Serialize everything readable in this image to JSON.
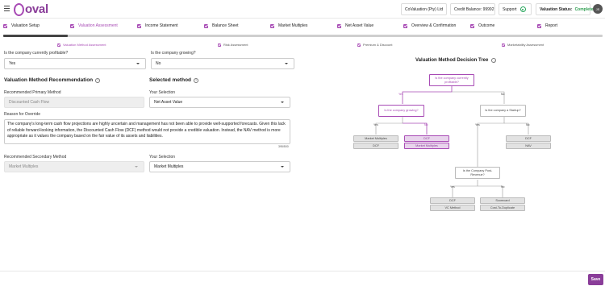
{
  "header": {
    "logo_text": "oval",
    "company": "CoValuation (Pty) Ltd",
    "credit_balance": "Credit Balance: 99992",
    "support": "Support",
    "status_label": "Valuation Status:",
    "status_value": "Complete",
    "avatar_initials": "JS"
  },
  "steps": [
    {
      "label": "Valuation Setup"
    },
    {
      "label": "Valuation Assessment"
    },
    {
      "label": "Income Statement"
    },
    {
      "label": "Balance Sheet"
    },
    {
      "label": "Market Multiples"
    },
    {
      "label": "Net Asset Value"
    },
    {
      "label": "Overview & Confirmation"
    },
    {
      "label": "Outcome"
    },
    {
      "label": "Report"
    }
  ],
  "substeps": [
    {
      "label": "Valuation Method Assessment"
    },
    {
      "label": "Risk Assessment"
    },
    {
      "label": "Premium & Discount"
    },
    {
      "label": "Marketability Assessment"
    }
  ],
  "form": {
    "profitable_label": "Is the company currently profitable?",
    "profitable_value": "Yes",
    "growing_label": "Is the company growing?",
    "growing_value": "No",
    "recommendation_heading": "Valuation Method Recommendation",
    "selected_heading": "Selected method",
    "rec_primary_label": "Recommended Primary Method",
    "rec_primary_value": "Discounted Cash Flow",
    "your_selection_label": "Your Selection",
    "primary_selection": "Net Asset Value",
    "override_label": "Reason for Override",
    "override_text": "The company's long-term cash flow projections are highly uncertain and management has not been able to provide well-supported forecasts. Given this lack of reliable forward-looking information, the Discounted Cash Flow (DCF) method would not provide a credible valuation. Instead, the NAV method is more appropriate as it values the company based on the fair value of its assets and liabilities.",
    "char_count": "395/500",
    "rec_secondary_label": "Recommended Secondary Method",
    "rec_secondary_value": "Market Multiples",
    "secondary_selection_label": "Your Selection",
    "secondary_selection": "Market Multiples"
  },
  "tree": {
    "title": "Valuation Method Decision Tree",
    "q_profitable": "Is the company currently profitable?",
    "q_growing": "Is the company growing?",
    "q_startup": "Is the company a Startup?",
    "q_post_revenue": "Is the Company Post-Revenue?",
    "yes": "Yes",
    "no": "No",
    "leaf_mm1": "Market Multiples",
    "leaf_dcf1": "DCF",
    "leaf_dcf2": "DCF",
    "leaf_mm2": "Market Multiples",
    "leaf_dcf3": "DCF",
    "leaf_dcf4": "DCF",
    "leaf_nav": "NAV",
    "leaf_vc": "VC Method",
    "leaf_scorecard": "Scorecard",
    "leaf_cost": "Cost-To-Duplicate"
  },
  "footer": {
    "save_label": "Save"
  },
  "colors": {
    "accent": "#a84bb5",
    "status_complete": "#2d9d4f"
  }
}
